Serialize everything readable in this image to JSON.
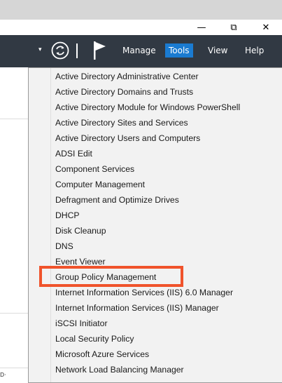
{
  "window": {
    "min_glyph": "—",
    "max_glyph": "⧉",
    "close_glyph": "✕"
  },
  "toolbar": {
    "dropdown_glyph": "▾",
    "menus": [
      "Manage",
      "Tools",
      "View",
      "Help"
    ],
    "active_menu": "Tools",
    "accent": "#1a7bd1",
    "bg": "#313943"
  },
  "tools_menu": {
    "items": [
      "Active Directory Administrative Center",
      "Active Directory Domains and Trusts",
      "Active Directory Module for Windows PowerShell",
      "Active Directory Sites and Services",
      "Active Directory Users and Computers",
      "ADSI Edit",
      "Component Services",
      "Computer Management",
      "Defragment and Optimize Drives",
      "DHCP",
      "Disk Cleanup",
      "DNS",
      "Event Viewer",
      "Group Policy Management",
      "Internet Information Services (IIS) 6.0 Manager",
      "Internet Information Services (IIS) Manager",
      "iSCSI Initiator",
      "Local Security Policy",
      "Microsoft Azure Services",
      "Network Load Balancing Manager"
    ],
    "highlighted_item": "Group Policy Management",
    "highlight_color": "#f0532b"
  },
  "left_pane": {
    "bottom_fragment": "D·"
  }
}
